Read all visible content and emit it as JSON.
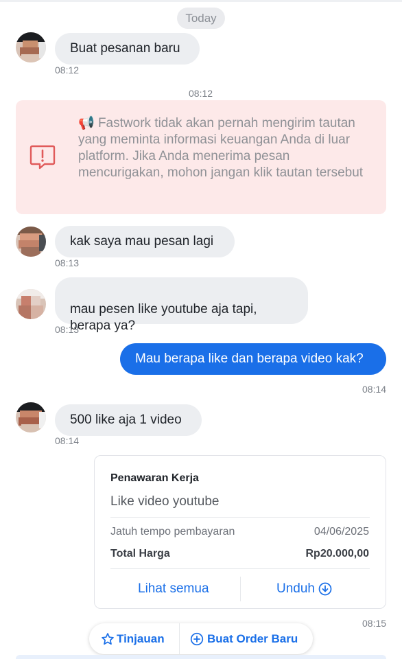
{
  "date_label": "Today",
  "messages": [
    {
      "text": "Buat pesanan baru",
      "time": "08:12"
    },
    {
      "text": "kak saya mau pesan lagi",
      "time": "08:13"
    },
    {
      "text": "mau pesen like youtube aja tapi,\nberapa ya?",
      "time": "08:13"
    },
    {
      "text": "Mau berapa like dan berapa video kak?",
      "time": "08:14"
    },
    {
      "text": "500 like aja 1 video",
      "time": "08:14"
    }
  ],
  "system_time": "08:12",
  "warning": {
    "megaphone": "📢",
    "text": "Fastwork tidak akan pernah mengirim tautan yang meminta informasi keuangan Anda di luar platform. Jika Anda menerima pesan mencurigakan, mohon jangan klik tautan tersebut"
  },
  "offer": {
    "title": "Penawaran Kerja",
    "job": "Like video youtube",
    "due_label": "Jatuh tempo pembayaran",
    "due_value": "04/06/2025",
    "total_label": "Total Harga",
    "total_value": "Rp20.000,00",
    "view_all": "Lihat semua",
    "download": "Unduh",
    "time": "08:15"
  },
  "actions": {
    "review": "Tinjauan",
    "new_order": "Buat Order Baru"
  },
  "colors": {
    "accent": "#1a6fe8",
    "incoming_bubble": "#eceef1",
    "warning_bg": "#fde9e9",
    "warning_icon": "#e05a5a"
  }
}
